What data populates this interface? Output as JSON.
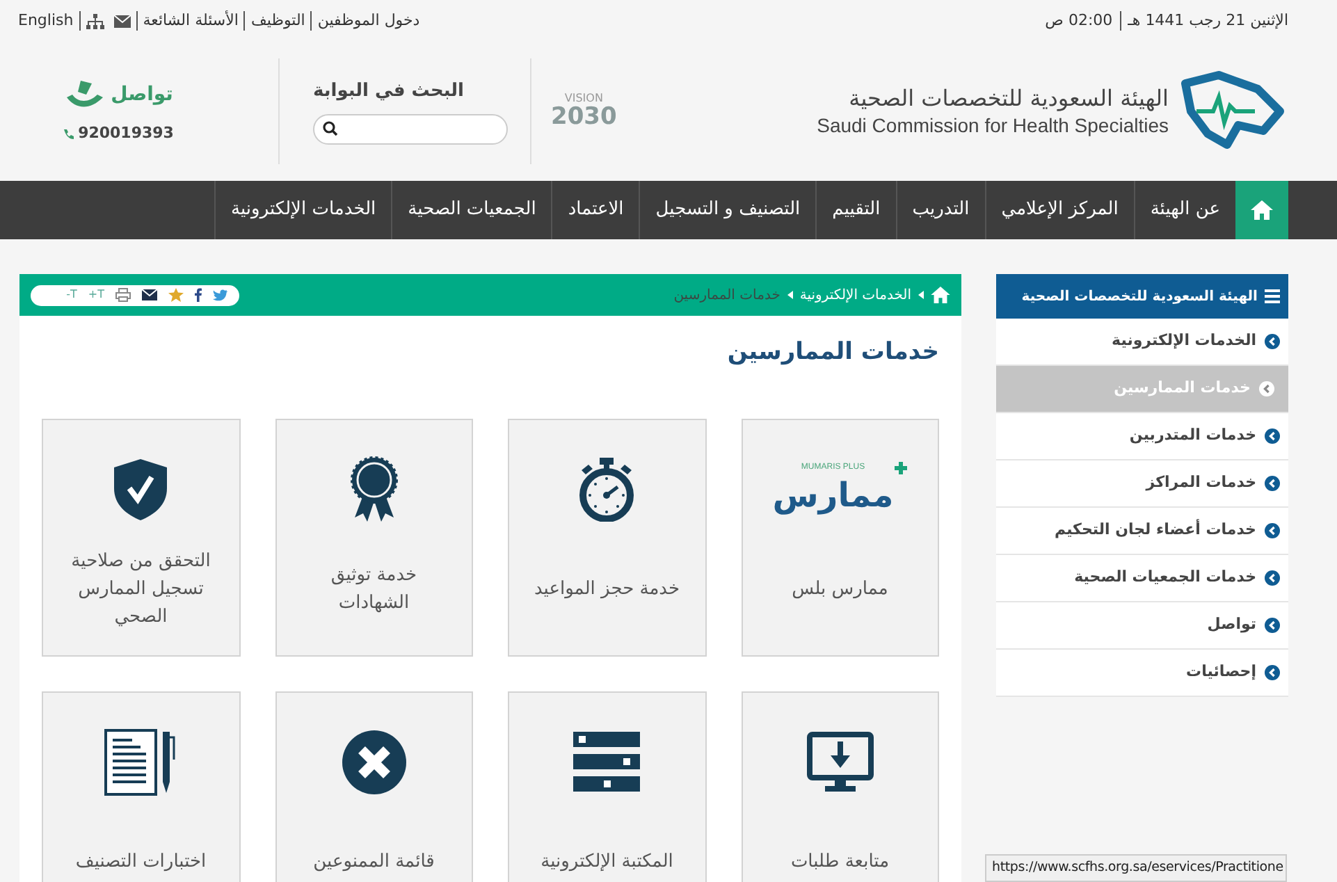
{
  "top_bar": {
    "date": "الإثنين 21 رجب 1441 هـ",
    "time": "02:00 ص",
    "links": [
      "دخول الموظفين",
      "التوظيف",
      "الأسئلة الشائعة"
    ],
    "language": "English"
  },
  "header": {
    "logo_ar": "الهيئة السعودية للتخصصات الصحية",
    "logo_en": "Saudi Commission for Health Specialties",
    "vision_label": "VISION",
    "vision_year": "2030",
    "search_title": "البحث في البوابة",
    "contact_label": "تواصل",
    "contact_phone": "920019393"
  },
  "nav": [
    {
      "kind": "home",
      "selected": true
    },
    {
      "kind": "link",
      "label": "عن الهيئة",
      "selected": false
    },
    {
      "kind": "link",
      "label": "المركز الإعلامي",
      "selected": false
    },
    {
      "kind": "link",
      "label": "التدريب",
      "selected": false
    },
    {
      "kind": "link",
      "label": "التقييم",
      "selected": false
    },
    {
      "kind": "link",
      "label": "التصنيف و التسجيل",
      "selected": false
    },
    {
      "kind": "link",
      "label": "الاعتماد",
      "selected": false
    },
    {
      "kind": "link",
      "label": "الجمعيات الصحية",
      "selected": false
    },
    {
      "kind": "link",
      "label": "الخدمات الإلكترونية",
      "selected": false
    }
  ],
  "breadcrumb": [
    "الخدمات الإلكترونية",
    "خدمات الممارسين"
  ],
  "text_size": [
    "T+",
    "T-"
  ],
  "page_title": "خدمات الممارسين",
  "cards": [
    {
      "kind": "mumaris",
      "logo_word": "ممارس",
      "logo_caption": "MUMARIS PLUS",
      "lines": [
        "ممارس بلس"
      ]
    },
    {
      "kind": "stopwatch",
      "lines": [
        "خدمة حجز المواعيد"
      ]
    },
    {
      "kind": "certificate",
      "lines": [
        "خدمة توثيق",
        "الشهادات"
      ]
    },
    {
      "kind": "shield",
      "lines": [
        "التحقق من صلاحية",
        "تسجيل الممارس",
        "الصحي"
      ]
    },
    {
      "kind": "monitor",
      "lines": [
        "متابعة طلبات"
      ]
    },
    {
      "kind": "library",
      "lines": [
        "المكتبة الإلكترونية"
      ]
    },
    {
      "kind": "ban",
      "lines": [
        "قائمة الممنوعين"
      ]
    },
    {
      "kind": "document",
      "lines": [
        "اختبارات التصنيف"
      ]
    }
  ],
  "sidebar": {
    "title": "الهيئة السعودية للتخصصات الصحية",
    "items": [
      {
        "label": "الخدمات الإلكترونية",
        "selected": false
      },
      {
        "label": "خدمات الممارسين",
        "selected": true
      },
      {
        "label": "خدمات المتدربين",
        "selected": false
      },
      {
        "label": "خدمات المراكز",
        "selected": false
      },
      {
        "label": "خدمات أعضاء لجان التحكيم",
        "selected": false
      },
      {
        "label": "خدمات الجمعيات الصحية",
        "selected": false
      },
      {
        "label": "تواصل",
        "selected": false
      },
      {
        "label": "إحصائيات",
        "selected": false
      }
    ]
  },
  "status_url": "https://www.scfhs.org.sa/eservices/Practitione"
}
